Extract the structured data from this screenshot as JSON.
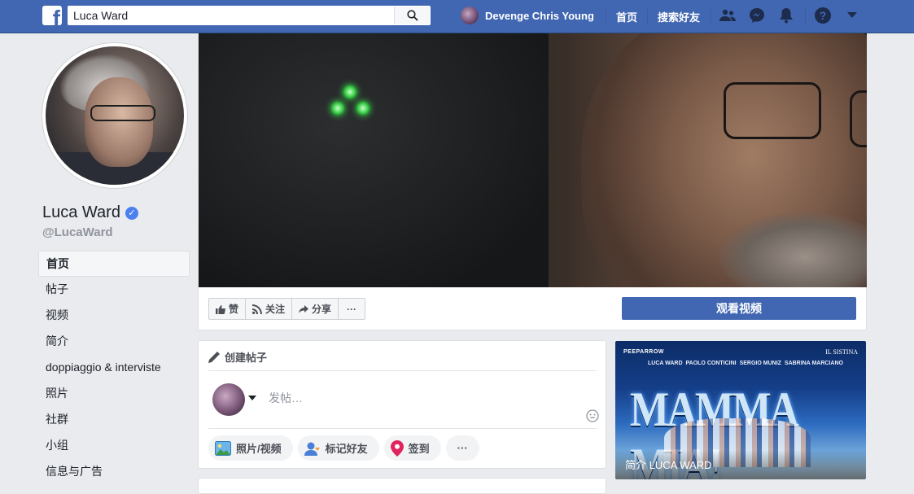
{
  "topbar": {
    "search_value": "Luca Ward",
    "user_name": "Devenge Chris Young",
    "home_label": "首页",
    "find_friends_label": "搜索好友"
  },
  "page": {
    "name": "Luca Ward",
    "handle": "@LucaWard"
  },
  "sidebar": {
    "items": [
      {
        "label": "首页",
        "active": true
      },
      {
        "label": "帖子"
      },
      {
        "label": "视频"
      },
      {
        "label": "简介"
      },
      {
        "label": "doppiaggio & interviste"
      },
      {
        "label": "照片"
      },
      {
        "label": "社群"
      },
      {
        "label": "小组"
      },
      {
        "label": "信息与广告"
      }
    ]
  },
  "cover_actions": {
    "like": "赞",
    "follow": "关注",
    "share": "分享",
    "more": "···",
    "watch_video": "观看视频"
  },
  "composer": {
    "header": "创建帖子",
    "placeholder": "发帖…",
    "photo_video": "照片/视频",
    "tag_friends": "标记好友",
    "check_in": "签到",
    "more": "···"
  },
  "promo": {
    "top_left": "PEEPARROW",
    "top_right": "IL SISTINA",
    "cast": [
      "LUCA WARD",
      "PAOLO CONTICINI",
      "SERGIO MUNIZ",
      "SABRINA MARCIANO"
    ],
    "title": "MAMMA MIA!",
    "caption": "简介 LUCA WARD"
  },
  "colors": {
    "brand": "#4267b2",
    "background": "#e9ebee",
    "verified": "#4c7ff0"
  }
}
